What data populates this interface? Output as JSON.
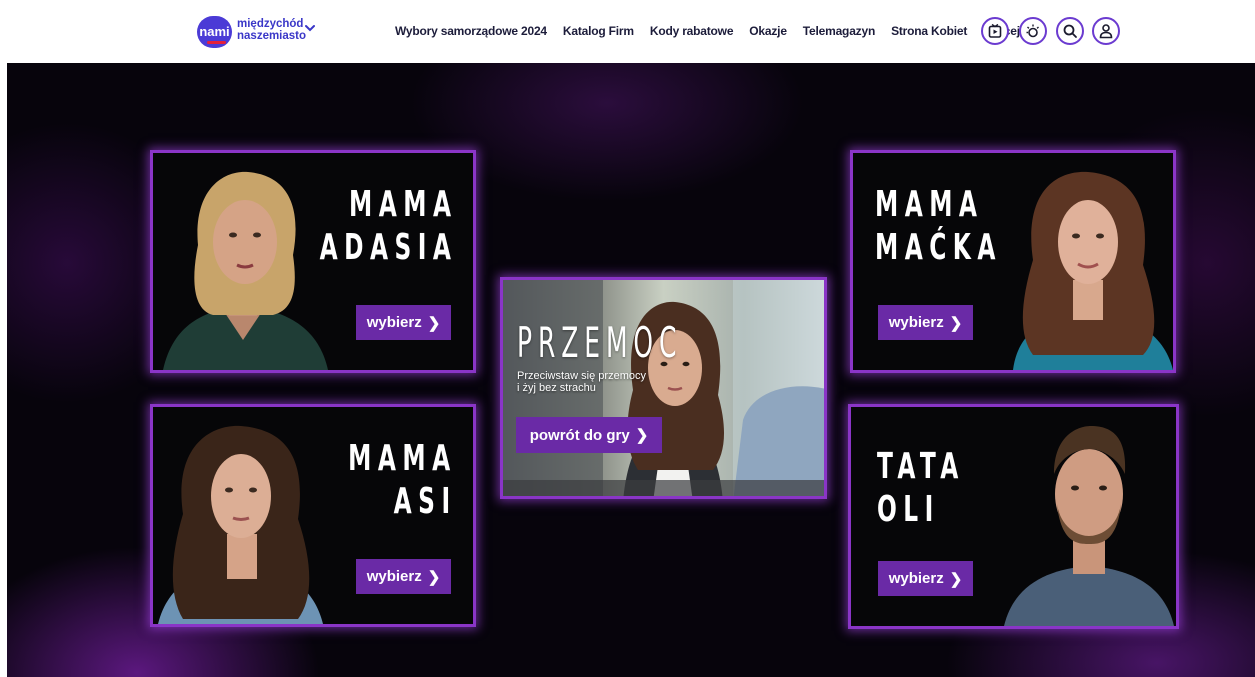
{
  "header": {
    "logo_text": "nami",
    "brand_line1": "międzychód",
    "brand_line2": "naszemiasto",
    "nav": [
      "Wybory samorządowe 2024",
      "Katalog Firm",
      "Kody rabatowe",
      "Okazje",
      "Telemagazyn",
      "Strona Kobiet"
    ],
    "more_label": "Więcej",
    "icons": [
      "tv-play-icon",
      "weather-icon",
      "search-icon",
      "user-icon"
    ],
    "accent_color": "#6b3bd0"
  },
  "game": {
    "card_border_color": "#8a35c7",
    "button_color": "#6a2aa6",
    "cards": [
      {
        "line1": "MAMA",
        "line2": "ADASIA",
        "button": "wybierz"
      },
      {
        "line1": "MAMA",
        "line2": "MAĆKA",
        "button": "wybierz"
      },
      {
        "line1": "MAMA",
        "line2": "ASI",
        "button": "wybierz"
      },
      {
        "line1": "TATA",
        "line2": "OLI",
        "button": "wybierz"
      }
    ],
    "center": {
      "title": "PRZEMOC",
      "subtitle_line1": "Przeciwstaw się przemocy",
      "subtitle_line2": "i żyj bez strachu",
      "button": "powrót do gry"
    }
  }
}
